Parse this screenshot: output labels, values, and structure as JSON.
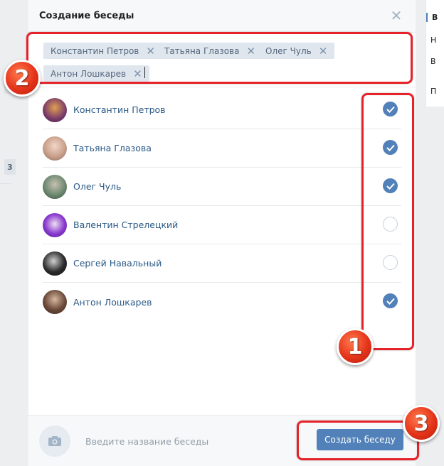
{
  "modal": {
    "title": "Создание беседы",
    "close_icon": "close-icon"
  },
  "selected_chips": [
    {
      "label": "Константин Петров"
    },
    {
      "label": "Татьяна Глазова"
    },
    {
      "label": "Олег Чуль"
    },
    {
      "label": "Антон Лошкарев"
    }
  ],
  "contacts": [
    {
      "name": "Константин Петров",
      "checked": true,
      "avatar_color": "#7a3a6a"
    },
    {
      "name": "Татьяна Глазова",
      "checked": true,
      "avatar_color": "#c9a08c"
    },
    {
      "name": "Олег Чуль",
      "checked": true,
      "avatar_color": "#6e8a72"
    },
    {
      "name": "Валентин Стрелецкий",
      "checked": false,
      "avatar_color": "#8a3ad0"
    },
    {
      "name": "Сергей Навальный",
      "checked": false,
      "avatar_color": "#2a2a2a"
    },
    {
      "name": "Антон Лошкарев",
      "checked": true,
      "avatar_color": "#6b4a3a"
    }
  ],
  "footer": {
    "name_placeholder": "Введите название беседы",
    "create_label": "Создать беседу",
    "camera_icon": "camera-icon"
  },
  "background": {
    "left_badge": "3",
    "right_menu": [
      "В",
      "Н",
      "В",
      "П"
    ]
  },
  "annotations": {
    "badge_1": "1",
    "badge_2": "2",
    "badge_3": "3",
    "highlight_color": "#e6232b"
  },
  "colors": {
    "accent": "#5181b8",
    "link": "#2a5885"
  }
}
